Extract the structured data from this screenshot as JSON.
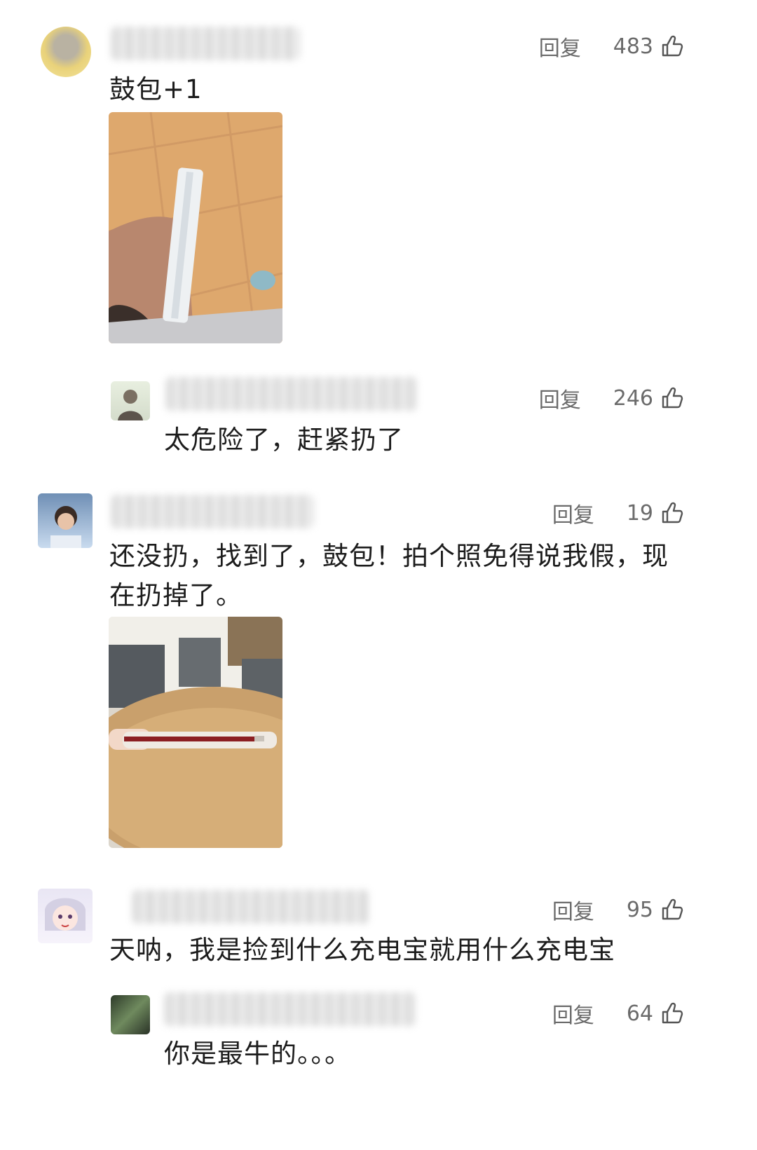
{
  "comments": [
    {
      "reply_label": "回复",
      "likes": "483",
      "text": "鼓包+1"
    },
    {
      "reply_label": "回复",
      "likes": "246",
      "text": "太危险了，赶紧扔了"
    },
    {
      "reply_label": "回复",
      "likes": "19",
      "text_line1": "还没扔，找到了，鼓包！拍个照免得说我假，现",
      "text_line2": "在扔掉了。"
    },
    {
      "reply_label": "回复",
      "likes": "95",
      "text": "天呐，我是捡到什么充电宝就用什么充电宝"
    },
    {
      "reply_label": "回复",
      "likes": "64",
      "text": "你是最牛的。。。"
    }
  ],
  "icons": {
    "like": "thumbs-up-icon"
  }
}
